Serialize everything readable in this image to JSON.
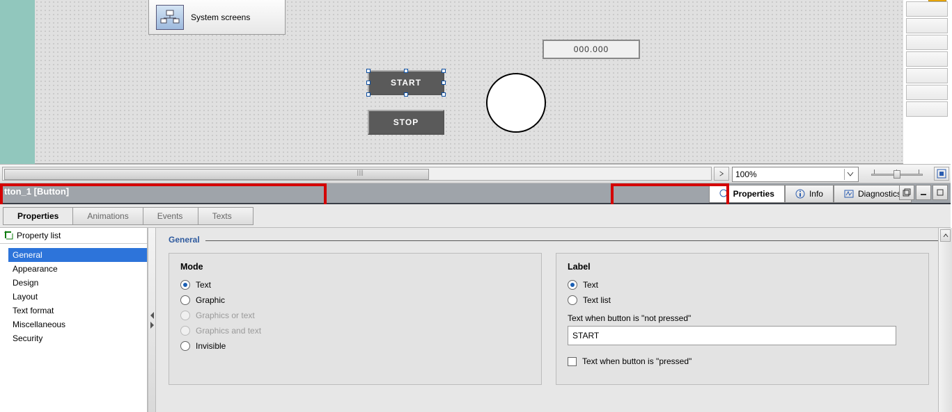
{
  "toolbar": {
    "system_screens_label": "System screens"
  },
  "hmi": {
    "start_label": "START",
    "stop_label": "STOP",
    "readout_value": "000.000"
  },
  "zoom": {
    "value": "100%"
  },
  "inspector": {
    "object_title": "tton_1 [Button]",
    "right_tabs": {
      "properties": "Properties",
      "info": "Info",
      "diagnostics": "Diagnostics"
    },
    "sub_tabs": {
      "properties": "Properties",
      "animations": "Animations",
      "events": "Events",
      "texts": "Texts"
    },
    "prop_list_head": "Property list",
    "prop_items": {
      "general": "General",
      "appearance": "Appearance",
      "design": "Design",
      "layout": "Layout",
      "text_format": "Text format",
      "miscellaneous": "Miscellaneous",
      "security": "Security"
    },
    "section_title": "General",
    "mode": {
      "head": "Mode",
      "text": "Text",
      "graphic": "Graphic",
      "graphics_or_text": "Graphics or text",
      "graphics_and_text": "Graphics and text",
      "invisible": "Invisible"
    },
    "label": {
      "head": "Label",
      "text": "Text",
      "text_list": "Text list",
      "not_pressed_label": "Text when button is \"not pressed\"",
      "not_pressed_value": "START",
      "pressed_label": "Text when button is \"pressed\""
    }
  }
}
